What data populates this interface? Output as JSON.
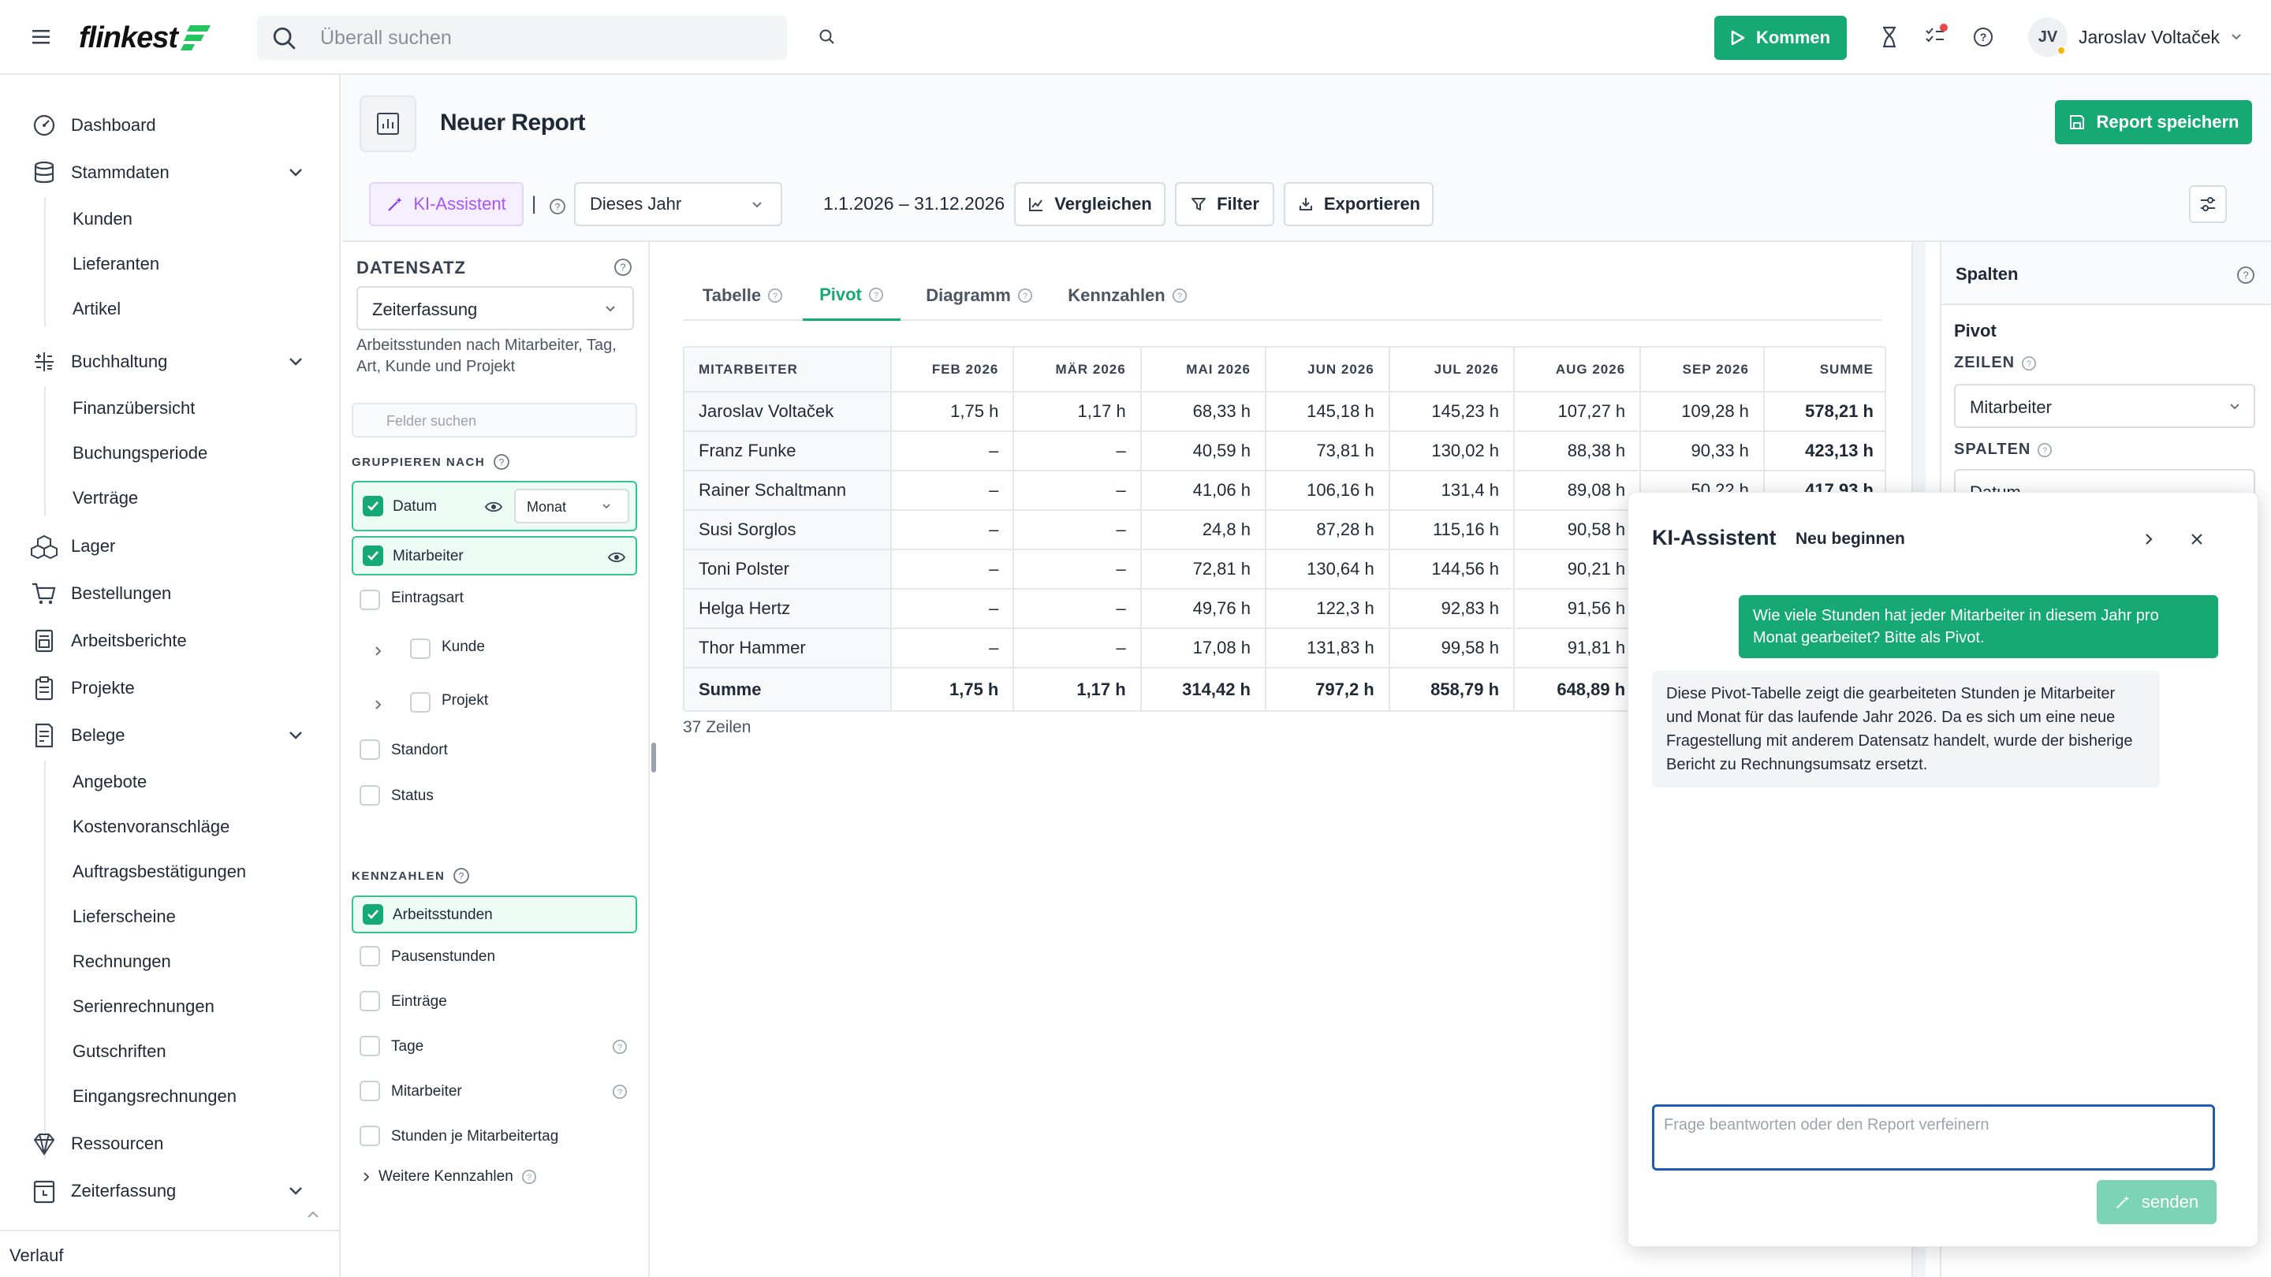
{
  "app": {
    "logo": "flinkest",
    "search_placeholder": "Überall suchen"
  },
  "topbar": {
    "kommen_label": "Kommen",
    "user_initials": "JV",
    "user_name": "Jaroslav Voltaček"
  },
  "sidebar": {
    "items": [
      {
        "label": "Dashboard",
        "icon": "dashboard-icon"
      },
      {
        "label": "Stammdaten",
        "icon": "database-icon",
        "expanded": true,
        "children": [
          "Kunden",
          "Lieferanten",
          "Artikel"
        ]
      },
      {
        "label": "Buchhaltung",
        "icon": "calculator-icon",
        "expanded": true,
        "children": [
          "Finanzübersicht",
          "Buchungsperiode",
          "Verträge"
        ]
      },
      {
        "label": "Lager",
        "icon": "boxes-icon"
      },
      {
        "label": "Bestellungen",
        "icon": "cart-icon"
      },
      {
        "label": "Arbeitsberichte",
        "icon": "report-icon"
      },
      {
        "label": "Projekte",
        "icon": "clipboard-icon"
      },
      {
        "label": "Belege",
        "icon": "receipt-icon",
        "expanded": true,
        "children": [
          "Angebote",
          "Kostenvoranschläge",
          "Auftragsbestätigungen",
          "Lieferscheine",
          "Rechnungen",
          "Serienrechnungen",
          "Gutschriften",
          "Eingangsrechnungen"
        ]
      },
      {
        "label": "Ressourcen",
        "icon": "gem-icon"
      },
      {
        "label": "Zeiterfassung",
        "icon": "clock-calendar-icon",
        "expanded": true
      }
    ],
    "footer": "Verlauf"
  },
  "page": {
    "title": "Neuer Report",
    "save_label": "Report speichern",
    "ai_button": "KI-Assistent",
    "separator": "|",
    "period_select": "Dieses Jahr",
    "date_range": "1.1.2026 – 31.12.2026",
    "compare_label": "Vergleichen",
    "filter_label": "Filter",
    "export_label": "Exportieren"
  },
  "dataset": {
    "title": "DATENSATZ",
    "selected": "Zeiterfassung",
    "description": "Arbeitsstunden nach Mitarbeiter, Tag, Art, Kunde und Projekt",
    "search_placeholder": "Felder suchen",
    "group_title": "GRUPPIEREN NACH",
    "group_fields": [
      {
        "label": "Datum",
        "checked": true,
        "sub_select": "Monat"
      },
      {
        "label": "Mitarbeiter",
        "checked": true
      },
      {
        "label": "Eintragsart",
        "checked": false
      },
      {
        "label": "Kunde",
        "checked": false
      },
      {
        "label": "Projekt",
        "checked": false
      },
      {
        "label": "Standort",
        "checked": false
      },
      {
        "label": "Status",
        "checked": false
      }
    ],
    "kpi_title": "KENNZAHLEN",
    "kpi_fields": [
      {
        "label": "Arbeitsstunden",
        "checked": true
      },
      {
        "label": "Pausenstunden",
        "checked": false
      },
      {
        "label": "Einträge",
        "checked": false
      },
      {
        "label": "Tage",
        "checked": false
      },
      {
        "label": "Mitarbeiter",
        "checked": false
      },
      {
        "label": "Stunden je Mitarbeitertag",
        "checked": false
      }
    ],
    "more_kpis": "Weitere Kennzahlen"
  },
  "tabs": [
    {
      "label": "Tabelle",
      "active": false
    },
    {
      "label": "Pivot",
      "active": true
    },
    {
      "label": "Diagramm",
      "active": false
    },
    {
      "label": "Kennzahlen",
      "active": false
    }
  ],
  "pivot": {
    "columns": [
      "MITARBEITER",
      "FEB 2026",
      "MÄR 2026",
      "MAI 2026",
      "JUN 2026",
      "JUL 2026",
      "AUG 2026",
      "SEP 2026",
      "SUMME"
    ],
    "rows": [
      [
        "Jaroslav Voltaček",
        "1,75 h",
        "1,17 h",
        "68,33 h",
        "145,18 h",
        "145,23 h",
        "107,27 h",
        "109,28 h",
        "578,21 h"
      ],
      [
        "Franz Funke",
        "–",
        "–",
        "40,59 h",
        "73,81 h",
        "130,02 h",
        "88,38 h",
        "90,33 h",
        "423,13 h"
      ],
      [
        "Rainer Schaltmann",
        "–",
        "–",
        "41,06 h",
        "106,16 h",
        "131,4 h",
        "89,08 h",
        "50,22 h",
        "417,93 h"
      ],
      [
        "Susi Sorglos",
        "–",
        "–",
        "24,8 h",
        "87,28 h",
        "115,16 h",
        "90,58 h",
        "",
        ""
      ],
      [
        "Toni Polster",
        "–",
        "–",
        "72,81 h",
        "130,64 h",
        "144,56 h",
        "90,21 h",
        "",
        ""
      ],
      [
        "Helga Hertz",
        "–",
        "–",
        "49,76 h",
        "122,3 h",
        "92,83 h",
        "91,56 h",
        "",
        ""
      ],
      [
        "Thor Hammer",
        "–",
        "–",
        "17,08 h",
        "131,83 h",
        "99,58 h",
        "91,81 h",
        "",
        ""
      ]
    ],
    "sum_row": [
      "Summe",
      "1,75 h",
      "1,17 h",
      "314,42 h",
      "797,2 h",
      "858,79 h",
      "648,89 h",
      "",
      ""
    ],
    "row_count": "37 Zeilen"
  },
  "rightpanel": {
    "title": "Spalten",
    "section": "Pivot",
    "rows_label": "ZEILEN",
    "rows_value": "Mitarbeiter",
    "cols_label": "SPALTEN",
    "cols_value": "Datum"
  },
  "assistant": {
    "title": "KI-Assistent",
    "restart": "Neu beginnen",
    "user_message": "Wie viele Stunden hat jeder Mitarbeiter in diesem Jahr pro Monat gearbeitet? Bitte als Pivot.",
    "bot_message": "Diese Pivot-Tabelle zeigt die gearbeiteten Stunden je Mitarbeiter und Monat für das laufende Jahr 2026. Da es sich um eine neue Fragestellung mit anderem Datensatz handelt, wurde der bisherige Bericht zu Rechnungsumsatz ersetzt.",
    "input_placeholder": "Frage beantworten oder den Report verfeinern",
    "send_label": "senden"
  },
  "colors": {
    "brand_green": "#17a974",
    "ai_purple": "#a855f7",
    "focus_blue": "#1e5bb8"
  }
}
